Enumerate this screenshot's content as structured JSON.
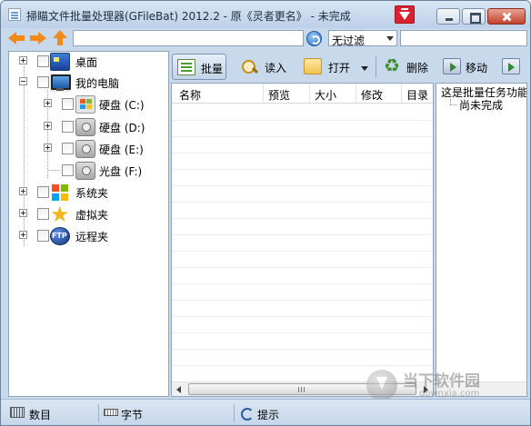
{
  "window": {
    "title": "掃瞄文件批量处理器(GFileBat) 2012.2 - 原《灵者更名》 - 未完成"
  },
  "address_bar": {
    "path_value": "",
    "filter_selected": "无过滤",
    "filter2_value": ""
  },
  "tree": {
    "items": [
      {
        "label": "桌面",
        "icon": "desktop-icon"
      },
      {
        "label": "我的电脑",
        "icon": "computer-icon"
      },
      {
        "label": "硬盘 (C:)",
        "icon": "windows-drive-icon"
      },
      {
        "label": "硬盘 (D:)",
        "icon": "hard-disk-icon"
      },
      {
        "label": "硬盘 (E:)",
        "icon": "hard-disk-icon"
      },
      {
        "label": "光盘 (F:)",
        "icon": "optical-disk-icon"
      },
      {
        "label": "系统夹",
        "icon": "system-folder-icon"
      },
      {
        "label": "虚拟夹",
        "icon": "star-icon"
      },
      {
        "label": "远程夹",
        "icon": "ftp-globe-icon"
      }
    ]
  },
  "toolbar": {
    "batch_label": "批量",
    "read_label": "读入",
    "open_label": "打开",
    "delete_label": "删除",
    "move_label": "移动"
  },
  "file_list": {
    "columns": [
      "名称",
      "预览",
      "大小",
      "修改",
      "目录"
    ]
  },
  "task_pane": {
    "root_label": "这是批量任务功能",
    "child_label": "尚未完成"
  },
  "status_bar": {
    "count_label": "数目",
    "bytes_label": "字节",
    "hint_label": "提示"
  },
  "watermark": {
    "title": "当下软件园",
    "url": "downxia.com"
  }
}
